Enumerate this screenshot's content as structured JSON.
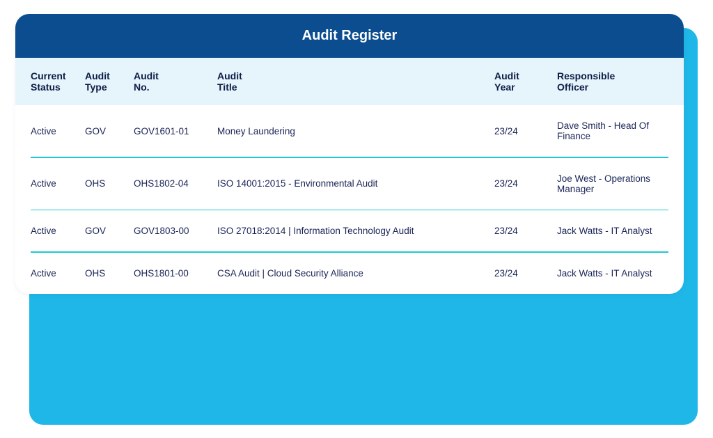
{
  "title": "Audit Register",
  "columns": {
    "status": {
      "line1": "Current",
      "line2": "Status"
    },
    "type": {
      "line1": "Audit",
      "line2": "Type"
    },
    "no": {
      "line1": "Audit",
      "line2": "No."
    },
    "title": {
      "line1": "Audit",
      "line2": "Title"
    },
    "year": {
      "line1": "Audit",
      "line2": "Year"
    },
    "officer": {
      "line1": "Responsible",
      "line2": "Officer"
    }
  },
  "rows": [
    {
      "status": "Active",
      "type": "GOV",
      "no": "GOV1601-01",
      "title": "Money Laundering",
      "year": "23/24",
      "officer": "Dave Smith - Head Of Finance"
    },
    {
      "status": "Active",
      "type": "OHS",
      "no": "OHS1802-04",
      "title": "ISO 14001:2015 - Environmental Audit",
      "year": "23/24",
      "officer": "Joe West - Operations Manager"
    },
    {
      "status": "Active",
      "type": "GOV",
      "no": "GOV1803-00",
      "title": "ISO 27018:2014 | Information Technology Audit",
      "year": "23/24",
      "officer": "Jack Watts - IT Analyst"
    },
    {
      "status": "Active",
      "type": "OHS",
      "no": "OHS1801-00",
      "title": "CSA Audit | Cloud Security Alliance",
      "year": "23/24",
      "officer": "Jack Watts - IT Analyst"
    }
  ]
}
